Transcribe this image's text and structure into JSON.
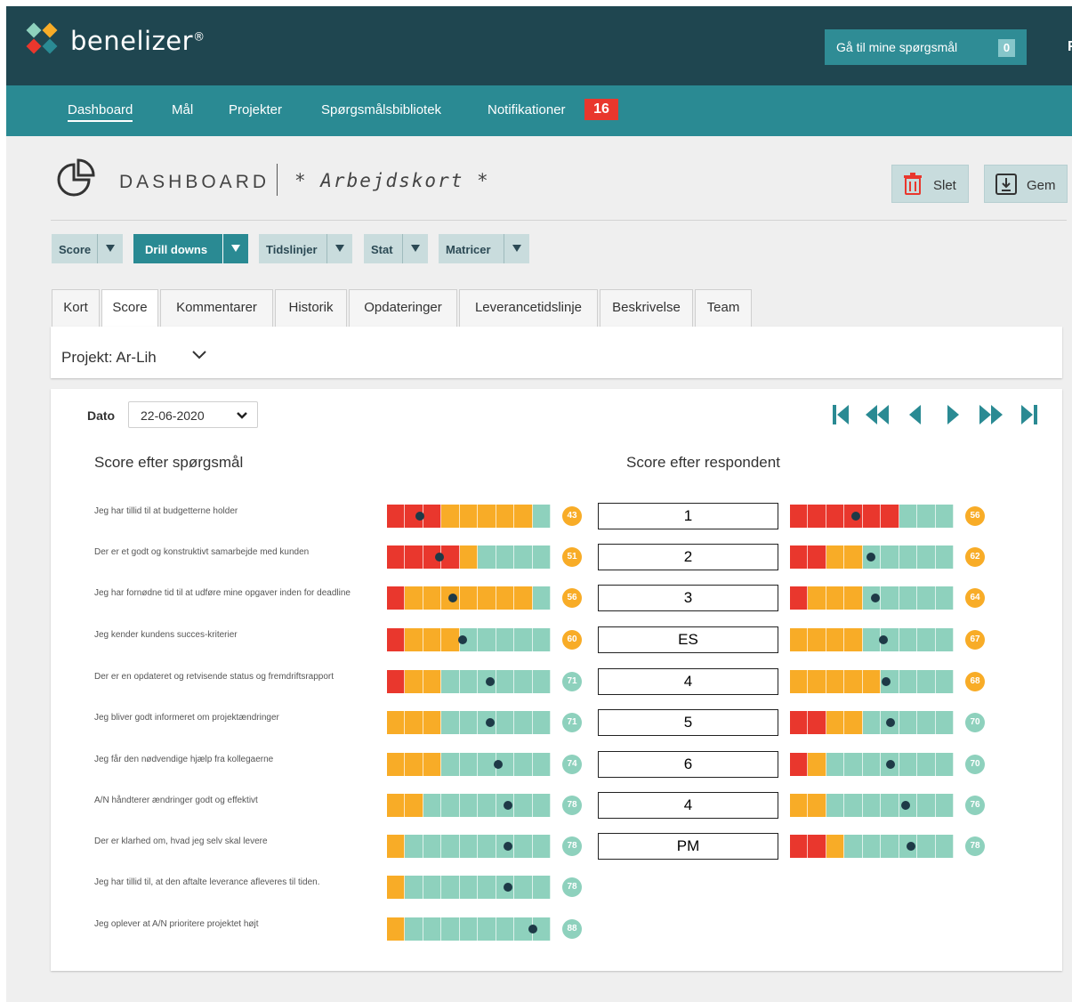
{
  "app": {
    "brand": "benelizer",
    "brand_mark": "®",
    "questions_button": "Gå til mine spørgsmål",
    "questions_count": "0",
    "edge_letter": "F"
  },
  "nav": {
    "items": [
      "Dashboard",
      "Mål",
      "Projekter",
      "Spørgsmålsbibliotek",
      "Notifikationer"
    ],
    "notification_count": "16"
  },
  "page": {
    "title": "DASHBOARD",
    "card_title": "* Arbejdskort *",
    "delete_label": "Slet",
    "save_label": "Gem"
  },
  "dropdowns": [
    "Score",
    "Drill downs",
    "Tidslinjer",
    "Stat",
    "Matricer"
  ],
  "tabs": [
    "Kort",
    "Score",
    "Kommentarer",
    "Historik",
    "Opdateringer",
    "Leverancetidslinje",
    "Beskrivelse",
    "Team"
  ],
  "active_tab": "Score",
  "project": {
    "label": "Projekt: Ar-Lih"
  },
  "date": {
    "label": "Dato",
    "value": "22-06-2020"
  },
  "sections": {
    "by_question": "Score efter spørgsmål",
    "by_respondent": "Score efter respondent"
  },
  "colors": {
    "red": "#e9372d",
    "orange": "#f8ac27",
    "teal": "#8ed1bd",
    "dot": "#1e3a47",
    "header": "#1f4650",
    "nav": "#2a8a93"
  },
  "questions": [
    {
      "text": "Jeg har tillid til at budgetterne holder",
      "score": 43,
      "segments": [
        "r",
        "r",
        "r",
        "o",
        "o",
        "o",
        "o",
        "o",
        "t"
      ]
    },
    {
      "text": "Der er et godt og konstruktivt samarbejde med kunden",
      "score": 51,
      "segments": [
        "r",
        "r",
        "r",
        "r",
        "o",
        "t",
        "t",
        "t",
        "t"
      ]
    },
    {
      "text": "Jeg har fornødne tid til at udføre mine opgaver inden for deadline",
      "score": 56,
      "segments": [
        "r",
        "o",
        "o",
        "o",
        "o",
        "o",
        "o",
        "o",
        "t"
      ]
    },
    {
      "text": "Jeg kender kundens succes-kriterier",
      "score": 60,
      "segments": [
        "r",
        "o",
        "o",
        "o",
        "t",
        "t",
        "t",
        "t",
        "t"
      ]
    },
    {
      "text": "Der er en opdateret og retvisende status og fremdriftsrapport",
      "score": 71,
      "segments": [
        "r",
        "o",
        "o",
        "t",
        "t",
        "t",
        "t",
        "t",
        "t"
      ]
    },
    {
      "text": "Jeg bliver godt informeret om projektændringer",
      "score": 71,
      "segments": [
        "o",
        "o",
        "o",
        "t",
        "t",
        "t",
        "t",
        "t",
        "t"
      ]
    },
    {
      "text": "Jeg får den nødvendige hjælp fra kollegaerne",
      "score": 74,
      "segments": [
        "o",
        "o",
        "o",
        "t",
        "t",
        "t",
        "t",
        "t",
        "t"
      ]
    },
    {
      "text": "A/N håndterer ændringer godt og effektivt",
      "score": 78,
      "segments": [
        "o",
        "o",
        "t",
        "t",
        "t",
        "t",
        "t",
        "t",
        "t"
      ]
    },
    {
      "text": "Der er klarhed om, hvad jeg selv skal levere",
      "score": 78,
      "segments": [
        "o",
        "t",
        "t",
        "t",
        "t",
        "t",
        "t",
        "t",
        "t"
      ]
    },
    {
      "text": "Jeg har tillid til, at den aftalte leverance afleveres til tiden.",
      "score": 78,
      "segments": [
        "o",
        "t",
        "t",
        "t",
        "t",
        "t",
        "t",
        "t",
        "t"
      ]
    },
    {
      "text": "Jeg oplever at A/N prioritere projektet højt",
      "score": 88,
      "segments": [
        "o",
        "t",
        "t",
        "t",
        "t",
        "t",
        "t",
        "t",
        "t"
      ]
    }
  ],
  "respondents": [
    {
      "label": "1",
      "score": 56,
      "segments": [
        "r",
        "r",
        "r",
        "r",
        "r",
        "r",
        "t",
        "t",
        "t"
      ]
    },
    {
      "label": "2",
      "score": 62,
      "segments": [
        "r",
        "r",
        "o",
        "o",
        "t",
        "t",
        "t",
        "t",
        "t"
      ]
    },
    {
      "label": "3",
      "score": 64,
      "segments": [
        "r",
        "o",
        "o",
        "o",
        "t",
        "t",
        "t",
        "t",
        "t"
      ]
    },
    {
      "label": "ES",
      "score": 67,
      "segments": [
        "o",
        "o",
        "o",
        "o",
        "t",
        "t",
        "t",
        "t",
        "t"
      ]
    },
    {
      "label": "4",
      "score": 68,
      "segments": [
        "o",
        "o",
        "o",
        "o",
        "o",
        "t",
        "t",
        "t",
        "t"
      ]
    },
    {
      "label": "5",
      "score": 70,
      "segments": [
        "r",
        "r",
        "o",
        "o",
        "t",
        "t",
        "t",
        "t",
        "t"
      ]
    },
    {
      "label": "6",
      "score": 70,
      "segments": [
        "r",
        "o",
        "t",
        "t",
        "t",
        "t",
        "t",
        "t",
        "t"
      ]
    },
    {
      "label": "4",
      "score": 76,
      "segments": [
        "o",
        "o",
        "t",
        "t",
        "t",
        "t",
        "t",
        "t",
        "t"
      ]
    },
    {
      "label": "PM",
      "score": 78,
      "segments": [
        "r",
        "r",
        "o",
        "t",
        "t",
        "t",
        "t",
        "t",
        "t"
      ]
    }
  ]
}
